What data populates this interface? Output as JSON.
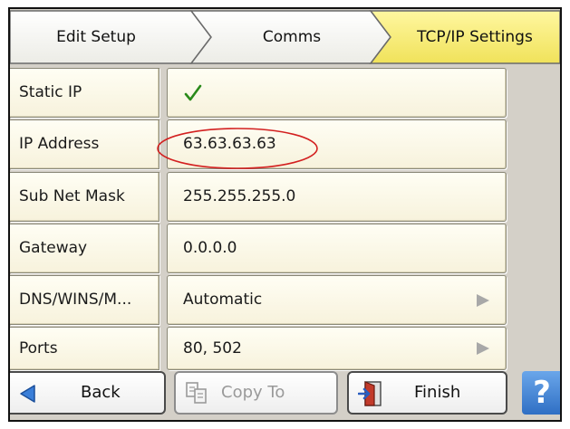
{
  "breadcrumb": {
    "items": [
      {
        "label": "Edit Setup"
      },
      {
        "label": "Comms"
      },
      {
        "label": "TCP/IP Settings",
        "active": true
      }
    ]
  },
  "settings": {
    "rows": [
      {
        "label": "Static IP",
        "value": "",
        "value_icon": "checkmark-icon",
        "has_arrow": false
      },
      {
        "label": "IP Address",
        "value": "63.63.63.63",
        "has_arrow": false,
        "annotated": true
      },
      {
        "label": "Sub Net Mask",
        "value": "255.255.255.0",
        "has_arrow": false
      },
      {
        "label": "Gateway",
        "value": "0.0.0.0",
        "has_arrow": false
      },
      {
        "label": "DNS/WINS/M...",
        "value": "Automatic",
        "has_arrow": true
      },
      {
        "label": "Ports",
        "value": "80, 502",
        "has_arrow": true
      }
    ]
  },
  "footer": {
    "back_label": "Back",
    "copy_label": "Copy To",
    "finish_label": "Finish",
    "help_label": "?"
  },
  "colors": {
    "active_crumb": "#f5ec72",
    "row_background": "#fbf7e6",
    "annotation": "#d32020",
    "checkmark": "#2a8a1a",
    "help_button": "#3f7fd0"
  }
}
